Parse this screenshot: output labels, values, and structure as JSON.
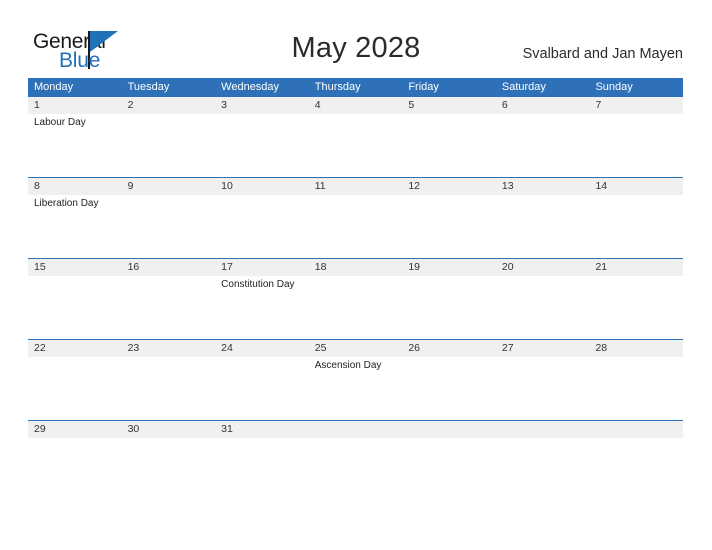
{
  "brand": {
    "name_part1": "General",
    "name_part2": "Blue",
    "flag_icon": "triangle-flag-icon",
    "color_dark": "#1a1a1a",
    "color_blue": "#1f72b8"
  },
  "header": {
    "title": "May 2028",
    "locale": "Svalbard and Jan Mayen"
  },
  "colors": {
    "header_blue": "#2e71b8",
    "row_band_gray": "#f0f0f0",
    "text_dark": "#2b2b2b",
    "page_background": "#ffffff"
  },
  "calendar": {
    "month": "May",
    "year": "2028",
    "weekdays": [
      "Monday",
      "Tuesday",
      "Wednesday",
      "Thursday",
      "Friday",
      "Saturday",
      "Sunday"
    ],
    "weeks": [
      [
        {
          "day": "1",
          "event": "Labour Day"
        },
        {
          "day": "2",
          "event": ""
        },
        {
          "day": "3",
          "event": ""
        },
        {
          "day": "4",
          "event": ""
        },
        {
          "day": "5",
          "event": ""
        },
        {
          "day": "6",
          "event": ""
        },
        {
          "day": "7",
          "event": ""
        }
      ],
      [
        {
          "day": "8",
          "event": "Liberation Day"
        },
        {
          "day": "9",
          "event": ""
        },
        {
          "day": "10",
          "event": ""
        },
        {
          "day": "11",
          "event": ""
        },
        {
          "day": "12",
          "event": ""
        },
        {
          "day": "13",
          "event": ""
        },
        {
          "day": "14",
          "event": ""
        }
      ],
      [
        {
          "day": "15",
          "event": ""
        },
        {
          "day": "16",
          "event": ""
        },
        {
          "day": "17",
          "event": "Constitution Day"
        },
        {
          "day": "18",
          "event": ""
        },
        {
          "day": "19",
          "event": ""
        },
        {
          "day": "20",
          "event": ""
        },
        {
          "day": "21",
          "event": ""
        }
      ],
      [
        {
          "day": "22",
          "event": ""
        },
        {
          "day": "23",
          "event": ""
        },
        {
          "day": "24",
          "event": ""
        },
        {
          "day": "25",
          "event": "Ascension Day"
        },
        {
          "day": "26",
          "event": ""
        },
        {
          "day": "27",
          "event": ""
        },
        {
          "day": "28",
          "event": ""
        }
      ],
      [
        {
          "day": "29",
          "event": ""
        },
        {
          "day": "30",
          "event": ""
        },
        {
          "day": "31",
          "event": ""
        },
        {
          "day": "",
          "event": ""
        },
        {
          "day": "",
          "event": ""
        },
        {
          "day": "",
          "event": ""
        },
        {
          "day": "",
          "event": ""
        }
      ]
    ]
  }
}
